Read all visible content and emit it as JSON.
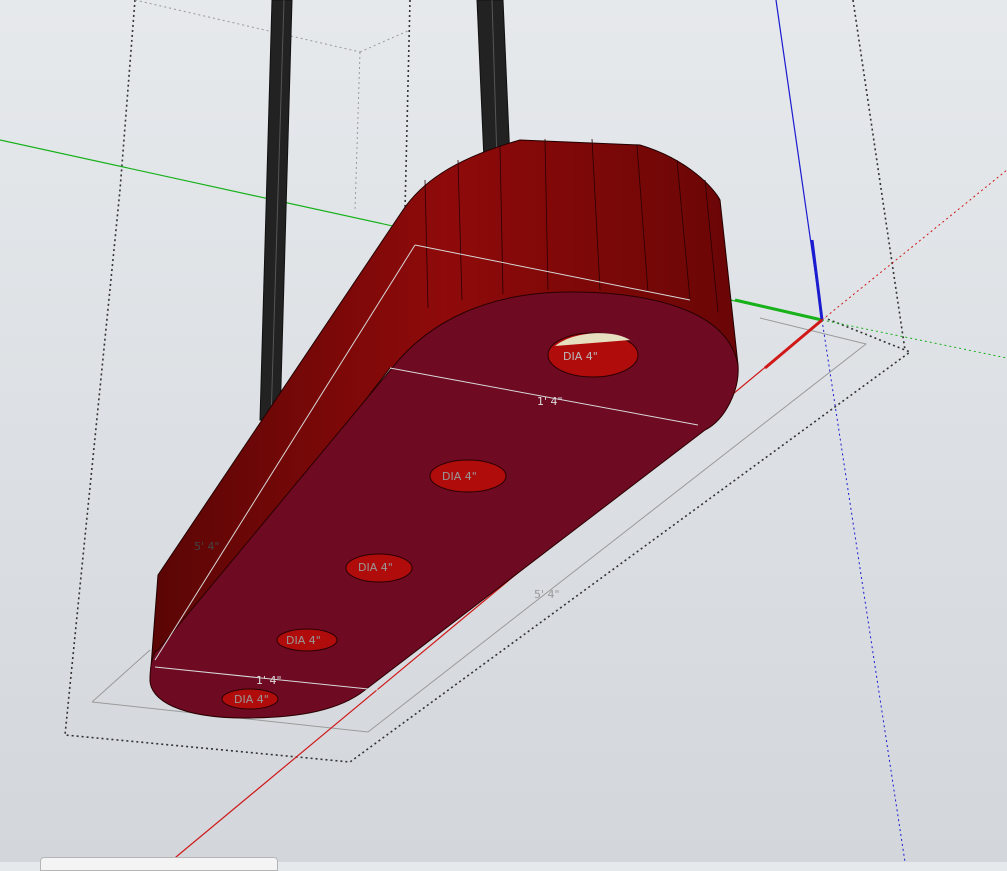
{
  "model": {
    "body_color": "#8b0a0a",
    "top_face_color": "#6e0a22",
    "hole_color": "#b00c0c",
    "rod_color": "#222222"
  },
  "axes": {
    "red": "#d01818",
    "green": "#17b11a",
    "blue": "#1b1bd0"
  },
  "dimensions": {
    "hole_top": "DIA 4\"",
    "hole_2": "DIA 4\"",
    "hole_3": "DIA 4\"",
    "hole_4": "DIA 4\"",
    "hole_bottom": "DIA 4\"",
    "width_top": "1' 4\"",
    "width_bottom": "1' 4\"",
    "length_left": "5' 4\"",
    "length_shadow": "5' 4\""
  }
}
